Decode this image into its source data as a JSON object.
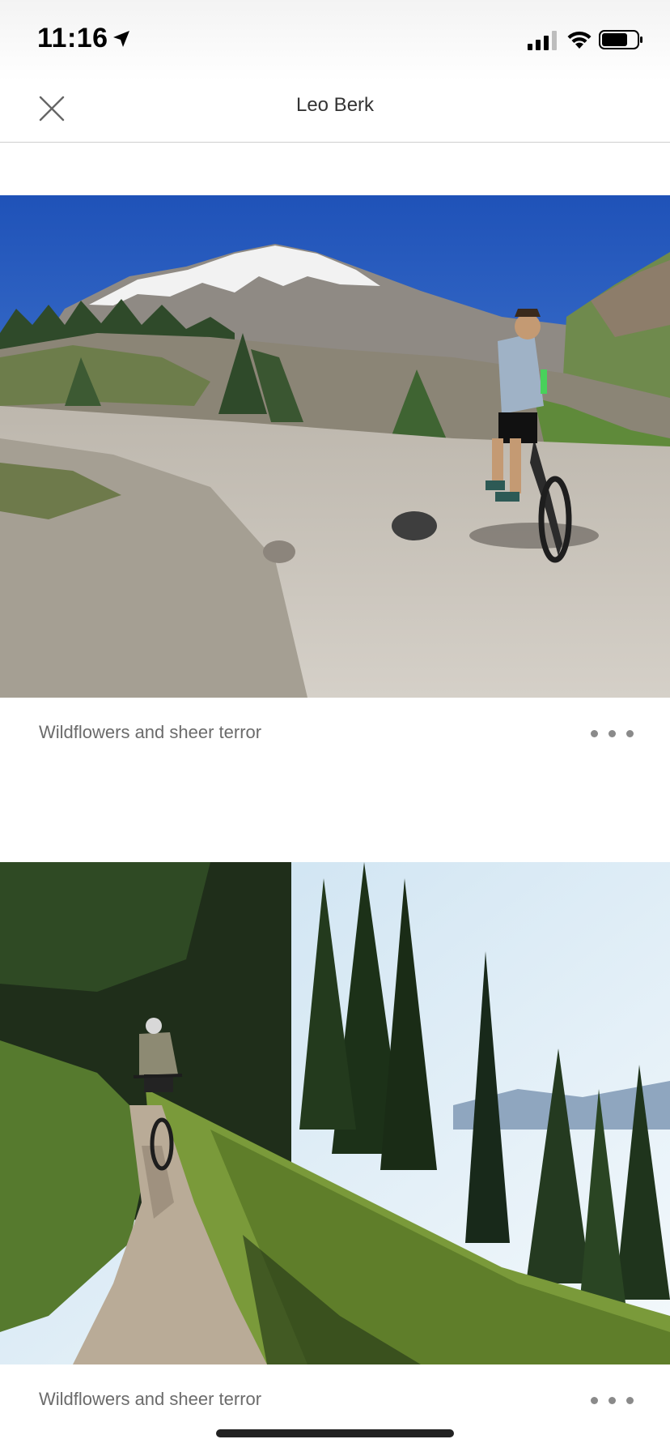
{
  "status_bar": {
    "time": "11:16",
    "location_icon": "location-arrow-icon",
    "signal_icon": "cellular-signal-icon",
    "wifi_icon": "wifi-icon",
    "battery_icon": "battery-icon"
  },
  "header": {
    "title": "Leo Berk",
    "close_icon": "close-icon"
  },
  "feed": {
    "posts": [
      {
        "caption": "Wildflowers and sheer terror",
        "photo_subject": "mountain-biker-on-volcano-trail",
        "more_icon": "more-dots-icon"
      },
      {
        "caption": "Wildflowers and sheer terror",
        "photo_subject": "mountain-biker-on-forest-singletrack",
        "more_icon": "more-dots-icon"
      }
    ]
  },
  "colors": {
    "caption": "#6b6b6b",
    "title": "#333333",
    "divider": "#cfcfcf",
    "sky_blue": "#2f63c4",
    "dots": "#8a8a8a"
  }
}
